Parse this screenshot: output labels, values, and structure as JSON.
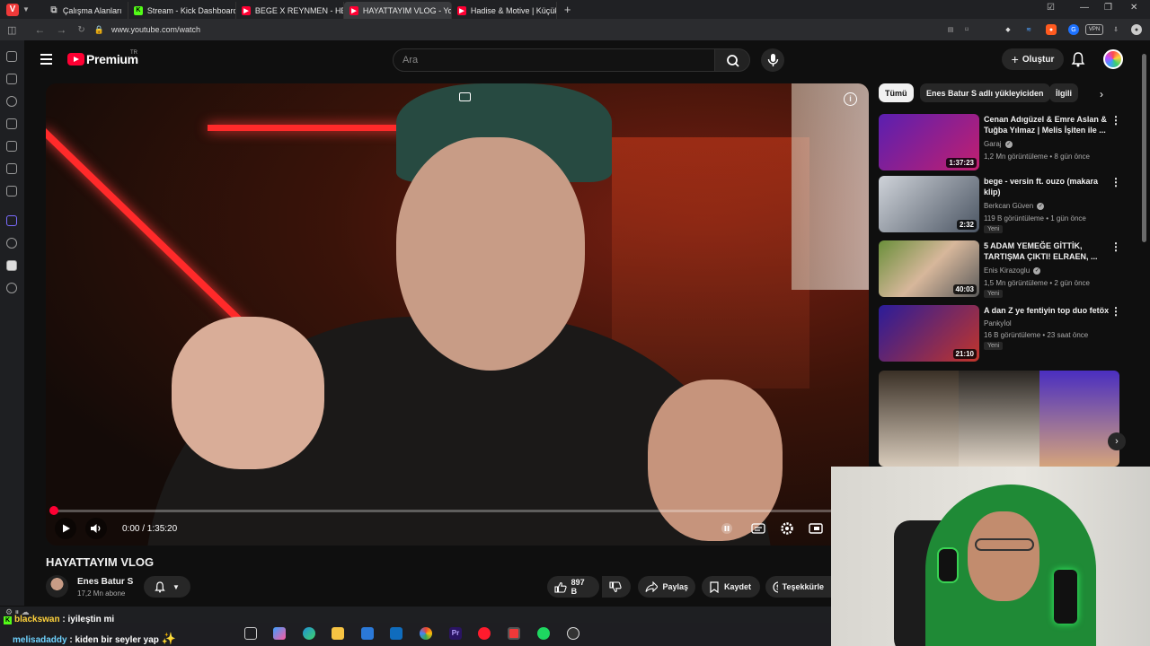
{
  "browser": {
    "tabs": [
      {
        "label": "Çalışma Alanları",
        "icon": "workspaces-icon"
      },
      {
        "label": "Stream - Kick Dashboard",
        "icon": "kick-icon"
      },
      {
        "label": "BEGE X REYNMEN - HER G",
        "icon": "youtube-icon"
      },
      {
        "label": "HAYATTAYIM VLOG - YouTu",
        "icon": "youtube-icon"
      },
      {
        "label": "Hadise & Motive | Küçük E",
        "icon": "youtube-icon"
      }
    ],
    "new_tab": "+",
    "url": "www.youtube.com/watch",
    "vpn_label": "VPN"
  },
  "yt": {
    "brand": "Premium",
    "region": "TR",
    "search_placeholder": "Ara",
    "create_label": "Oluştur"
  },
  "video": {
    "title": "HAYATTAYIM VLOG",
    "time": "0:00 / 1:35:20",
    "progress": 0.0,
    "channel": "Enes Batur S",
    "subscribers": "17,2 Mn abone",
    "likes": "897 B",
    "share_label": "Paylaş",
    "save_label": "Kaydet",
    "thanks_label": "Teşekkürle"
  },
  "chips": [
    "Tümü",
    "Enes Batur S adlı yükleyiciden",
    "İlgili"
  ],
  "recommendations": [
    {
      "title": "Cenan Adıgüzel & Emre Aslan & Tuğba Yılmaz | Melis İşiten ile ...",
      "channel": "Garaj",
      "meta": "1,2 Mn görüntüleme • 8 gün önce",
      "duration": "1:37:23",
      "badge": ""
    },
    {
      "title": "bege - versin ft. ouzo (makara klip)",
      "channel": "Berkcan Güven",
      "meta": "119 B görüntüleme • 1 gün önce",
      "duration": "2:32",
      "badge": "Yeni"
    },
    {
      "title": "5 ADAM YEMEĞE GİTTİK, TARTIŞMA ÇIKTI! ELRAEN, ...",
      "channel": "Enis Kirazoglu",
      "meta": "1,5 Mn görüntüleme • 2 gün önce",
      "duration": "40:03",
      "badge": "Yeni"
    },
    {
      "title": "A dan Z ye fentiyin top duo fetöx",
      "channel": "Pankyİol",
      "meta": "16 B görüntüleme • 23 saat önce",
      "duration": "21:10",
      "badge": "Yeni"
    }
  ],
  "chat": [
    {
      "user": "blackswan",
      "message": "iyileştin mi",
      "user_color": "#ffd23c"
    },
    {
      "user": "melisadaddy",
      "message": "kiden bir seyler yap",
      "user_color": "#6fd3ff"
    }
  ]
}
